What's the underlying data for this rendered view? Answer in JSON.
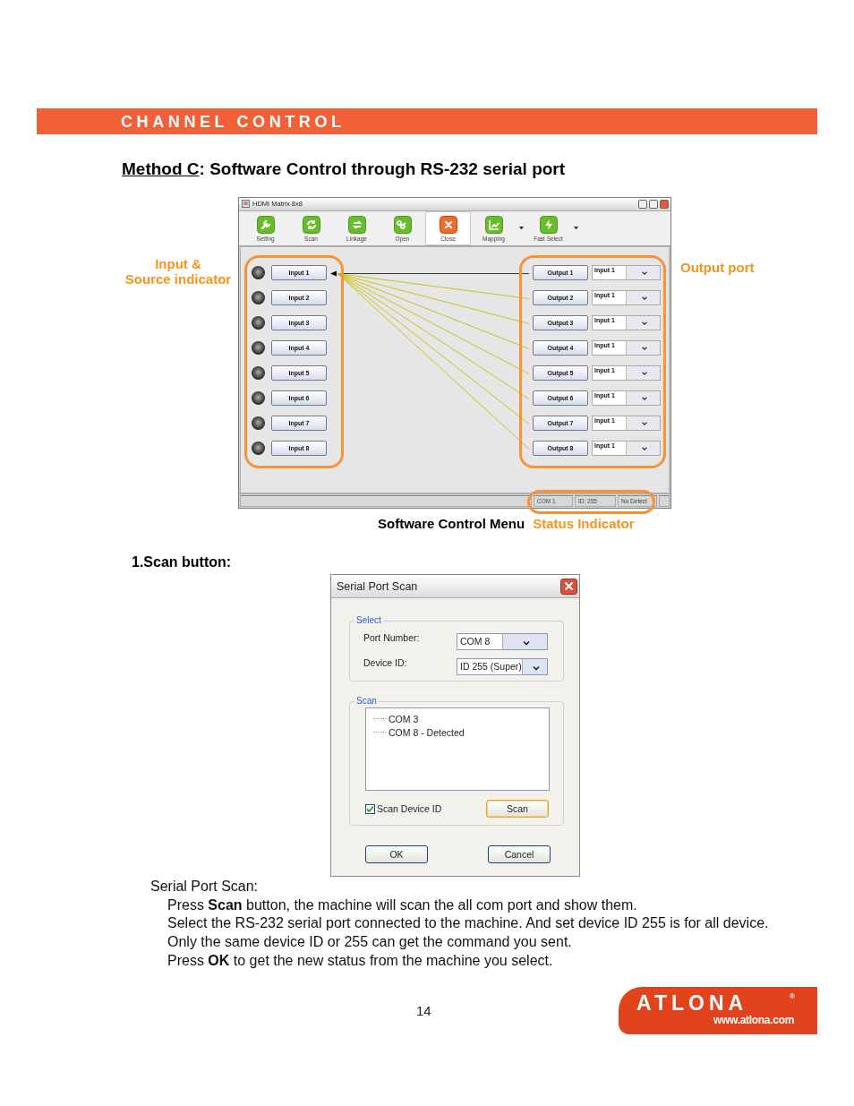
{
  "header": {
    "title": "CHANNEL CONTROL"
  },
  "heading": {
    "link": "Method C",
    "rest": ": Software Control through RS-232 serial port"
  },
  "input_callout": {
    "lines": [
      "Input &",
      "Source indicator"
    ]
  },
  "output_callout": {
    "text": "Output port"
  },
  "app": {
    "title": "HDMI Matrix 8x8",
    "toolbar": [
      {
        "label": "Setting",
        "selected": false,
        "dropdown": false
      },
      {
        "label": "Scan",
        "selected": false,
        "dropdown": false
      },
      {
        "label": "Linkage",
        "selected": false,
        "dropdown": false
      },
      {
        "label": "Open",
        "selected": false,
        "dropdown": false
      },
      {
        "label": "Close",
        "selected": true,
        "dropdown": false
      },
      {
        "label": "Mapping",
        "selected": false,
        "dropdown": true
      },
      {
        "label": "Fast Select",
        "selected": false,
        "dropdown": true
      }
    ],
    "inputs": [
      "Input 1",
      "Input 2",
      "Input 3",
      "Input 4",
      "Input 5",
      "Input 6",
      "Input 7",
      "Input 8"
    ],
    "outputs": [
      {
        "label": "Output 1",
        "source": "Input 1"
      },
      {
        "label": "Output 2",
        "source": "Input 1"
      },
      {
        "label": "Output 3",
        "source": "Input 1"
      },
      {
        "label": "Output 4",
        "source": "Input 1"
      },
      {
        "label": "Output 5",
        "source": "Input 1"
      },
      {
        "label": "Output 6",
        "source": "Input 1"
      },
      {
        "label": "Output 7",
        "source": "Input 1"
      },
      {
        "label": "Output 8",
        "source": "Input 1"
      }
    ],
    "status_bar": [
      "COM 1",
      "ID: 255",
      "No Detect"
    ]
  },
  "captions": {
    "menu": "Software Control Menu",
    "status": "Status Indicator"
  },
  "section_label": "1.Scan button:",
  "dialog": {
    "title": "Serial Port Scan",
    "select_group": {
      "legend": "Select",
      "fields": [
        {
          "label": "Port Number:",
          "value": "COM 8"
        },
        {
          "label": "Device ID:",
          "value": "ID 255 (Super)"
        }
      ]
    },
    "scan_group": {
      "legend": "Scan",
      "tree": [
        "COM 3",
        "COM 8 - Detected"
      ],
      "checkbox": {
        "label": "Scan Device ID",
        "checked": true
      },
      "button": "Scan"
    },
    "buttons": [
      "OK",
      "Cancel"
    ]
  },
  "body": {
    "title": "Serial Port Scan:",
    "lines": [
      "Press **Scan** button, the machine will scan the all com port and show them.",
      "Select the RS-232 serial port connected to the machine. And set device ID 255 is for all device.",
      "Only the same device ID or 255 can get the command you sent.",
      "Press **OK** to get the new status from the machine you select."
    ]
  },
  "page_number": "14",
  "logo": {
    "wordmark": "ATLONA",
    "mark": "®",
    "url": "www.atlona.com"
  }
}
